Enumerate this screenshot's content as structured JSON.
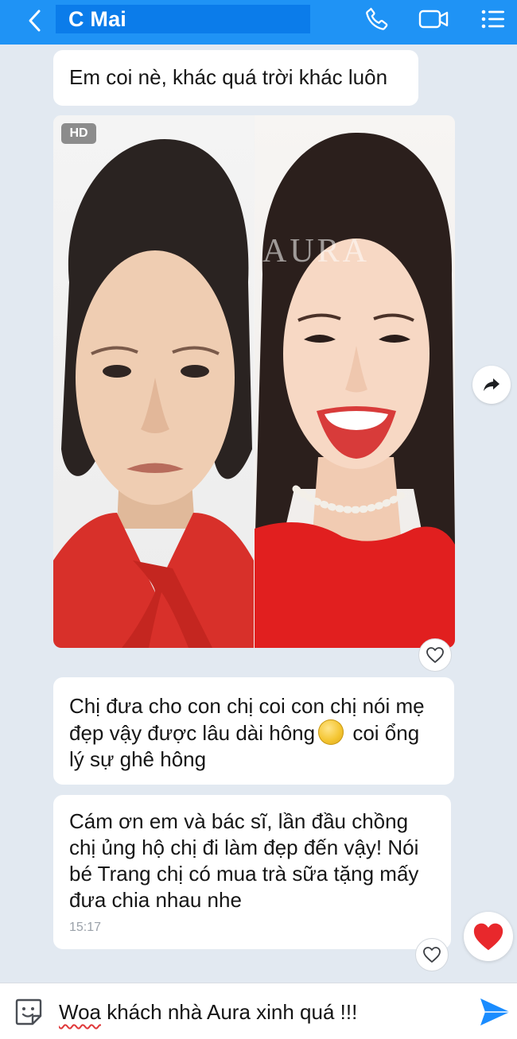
{
  "header": {
    "back_icon": "chevron-left-icon",
    "contact_name": "C Mai",
    "call_icon": "phone-icon",
    "video_icon": "video-camera-icon",
    "menu_icon": "list-menu-icon",
    "background_color": "#1f93f5"
  },
  "messages": [
    {
      "text": "Em coi nè, khác quá trời khác luôn"
    },
    {
      "type": "photo",
      "badge": "HD",
      "watermark": "AURA",
      "like_icon": "heart-outline-icon",
      "share_icon": "share-arrow-icon"
    },
    {
      "text_before_emoji": "Chị đưa cho con chị coi con chị nói mẹ đẹp vậy được lâu dài hông",
      "emoji": "coin-emoji",
      "text_after_emoji": " coi ổng lý sự ghê hông",
      "like_icon": "heart-outline-icon"
    },
    {
      "text": "Cám ơn em và bác sĩ, lần đầu chồng chị ủng hộ chị đi làm đẹp đến vậy! Nói bé Trang chị có mua trà sữa tặng mấy đưa chia nhau nhe",
      "time": "15:17",
      "reaction": "red-heart-icon"
    }
  ],
  "composer": {
    "sticker_icon": "smiley-sticker-icon",
    "first_word": "Woa",
    "rest_text": " khách nhà Aura xinh quá !!!",
    "send_icon": "send-arrow-icon",
    "accent_color": "#1a8cff"
  }
}
